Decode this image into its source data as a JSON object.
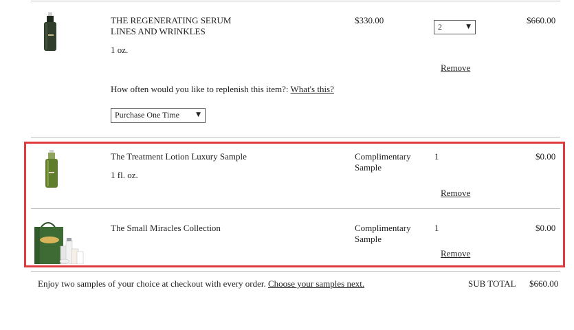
{
  "items": [
    {
      "name_line1": "THE REGENERATING SERUM",
      "name_line2": "LINES AND WRINKLES",
      "size": "1 oz.",
      "price": "$330.00",
      "quantity": "2",
      "total": "$660.00",
      "remove_label": "Remove",
      "replenish_prompt": "How often would you like to replenish this item?:",
      "replenish_link": "What's this?",
      "replenish_select_value": "Purchase One Time",
      "image_icon": "serum-bottle-icon"
    },
    {
      "name_line1": "The Treatment Lotion Luxury Sample",
      "size": "1 fl. oz.",
      "price_line1": "Complimentary",
      "price_line2": "Sample",
      "quantity": "1",
      "total": "$0.00",
      "remove_label": "Remove",
      "image_icon": "lotion-bottle-icon"
    },
    {
      "name_line1": "The Small Miracles Collection",
      "price_line1": "Complimentary",
      "price_line2": "Sample",
      "quantity": "1",
      "total": "$0.00",
      "remove_label": "Remove",
      "image_icon": "gift-bag-collection-icon"
    }
  ],
  "footer": {
    "samples_text": "Enjoy two samples of your choice at checkout with every order.",
    "samples_link": "Choose your samples next.",
    "subtotal_label": "SUB TOTAL",
    "subtotal_value": "$660.00"
  },
  "colors": {
    "highlight_border": "#e0393e",
    "bottle_green": "#2f3d2a",
    "lotion_green": "#5f7d2c",
    "bag_green": "#3e6b34"
  }
}
